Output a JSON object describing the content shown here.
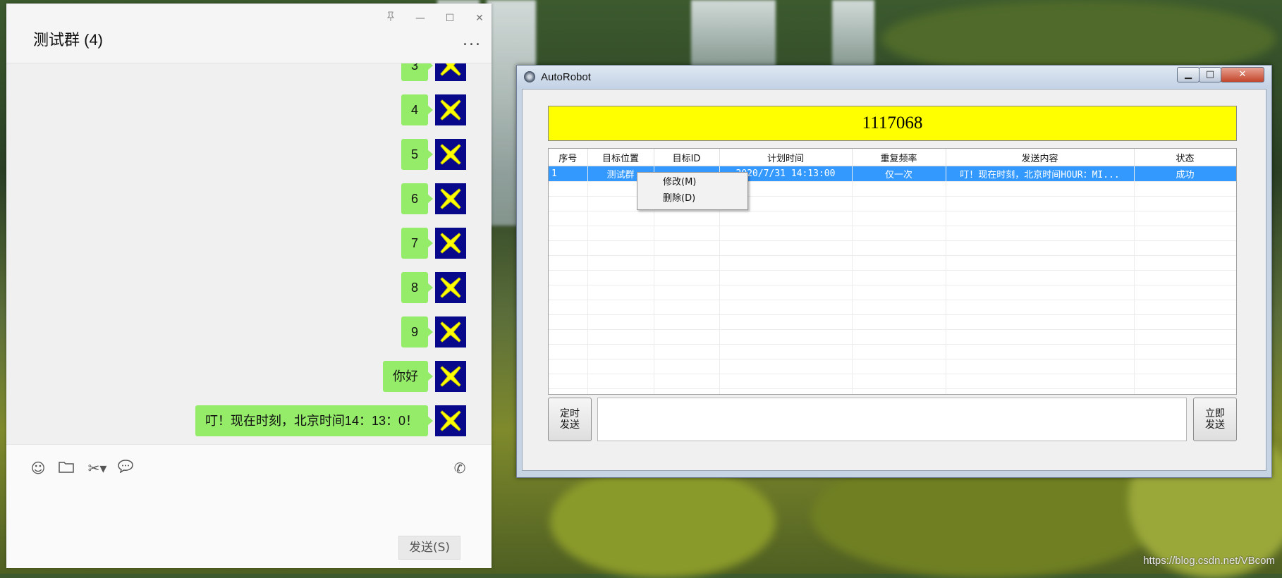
{
  "chat": {
    "title": "测试群 (4)",
    "window_controls": [
      "pin-icon",
      "minimize-icon",
      "maximize-icon",
      "close-icon"
    ],
    "more_label": "...",
    "messages": [
      {
        "text": "3"
      },
      {
        "text": "4"
      },
      {
        "text": "5"
      },
      {
        "text": "6"
      },
      {
        "text": "7"
      },
      {
        "text": "8"
      },
      {
        "text": "9"
      },
      {
        "text": "你好"
      },
      {
        "text": "叮！现在时刻，北京时间14：13：0！"
      }
    ],
    "toolbar_icons": [
      "emoji-icon",
      "folder-icon",
      "scissors-icon",
      "chat-bubble-icon",
      "video-call-icon"
    ],
    "send_label": "发送(S)",
    "colors": {
      "bubble": "#95ec69",
      "avatar_bg": "#08088a",
      "avatar_x": "#ffff00"
    }
  },
  "robot": {
    "title": "AutoRobot",
    "banner_value": "1117068",
    "table": {
      "columns": [
        "序号",
        "目标位置",
        "目标ID",
        "计划时间",
        "重复频率",
        "发送内容",
        "状态"
      ],
      "rows": [
        [
          "1",
          "测试群",
          "",
          "2020/7/31 14:13:00",
          "仅一次",
          "叮！现在时刻，北京时间HOUR：MI...",
          "成功"
        ]
      ]
    },
    "context_menu": [
      "修改(M)",
      "删除(D)"
    ],
    "timed_send_label": "定时\n发送",
    "send_now_label": "立即\n发送",
    "colors": {
      "banner": "#ffff00",
      "selected_row": "#3399ff"
    }
  },
  "watermark": "https://blog.csdn.net/VBcom"
}
